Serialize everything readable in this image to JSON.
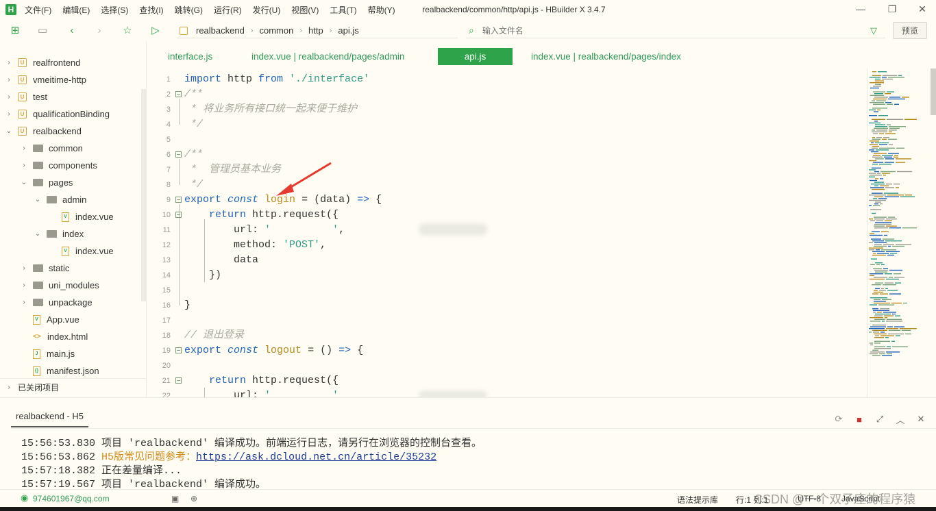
{
  "app": {
    "window_title": "realbackend/common/http/api.js - HBuilder X 3.4.7",
    "logo_letter": "H",
    "menu": [
      "文件(F)",
      "编辑(E)",
      "选择(S)",
      "查找(I)",
      "跳转(G)",
      "运行(R)",
      "发行(U)",
      "视图(V)",
      "工具(T)",
      "帮助(Y)"
    ]
  },
  "toolbar": {
    "breadcrumb": [
      "realbackend",
      "common",
      "http",
      "api.js"
    ],
    "file_search_placeholder": "输入文件名",
    "preview_label": "预览"
  },
  "sidebar": {
    "items": [
      {
        "label": "realfrontend",
        "type": "project",
        "arrow": "›"
      },
      {
        "label": "vmeitime-http",
        "type": "project",
        "arrow": "›"
      },
      {
        "label": "test",
        "type": "project",
        "arrow": "›"
      },
      {
        "label": "qualificationBinding",
        "type": "project",
        "arrow": "›"
      },
      {
        "label": "realbackend",
        "type": "project",
        "arrow": "⌄"
      },
      {
        "label": "common",
        "type": "folder",
        "arrow": "›"
      },
      {
        "label": "components",
        "type": "folder",
        "arrow": "›"
      },
      {
        "label": "pages",
        "type": "folder",
        "arrow": "⌄"
      },
      {
        "label": "admin",
        "type": "folder",
        "arrow": "⌄"
      },
      {
        "label": "index.vue",
        "type": "vue",
        "arrow": ""
      },
      {
        "label": "index",
        "type": "folder",
        "arrow": "⌄"
      },
      {
        "label": "index.vue",
        "type": "vue",
        "arrow": ""
      },
      {
        "label": "static",
        "type": "folder",
        "arrow": "›"
      },
      {
        "label": "uni_modules",
        "type": "folder",
        "arrow": "›"
      },
      {
        "label": "unpackage",
        "type": "folder",
        "arrow": "›"
      },
      {
        "label": "App.vue",
        "type": "vue",
        "arrow": ""
      },
      {
        "label": "index.html",
        "type": "html",
        "arrow": ""
      },
      {
        "label": "main.js",
        "type": "js",
        "arrow": ""
      },
      {
        "label": "manifest.json",
        "type": "json",
        "arrow": ""
      }
    ],
    "closed_projects_label": "已关闭项目"
  },
  "tabs": [
    {
      "label": "interface.js",
      "active": false
    },
    {
      "label": "index.vue | realbackend/pages/admin",
      "active": false
    },
    {
      "label": "api.js",
      "active": true
    },
    {
      "label": "index.vue | realbackend/pages/index",
      "active": false
    }
  ],
  "code": {
    "line_numbers": [
      "1",
      "2",
      "3",
      "4",
      "5",
      "6",
      "7",
      "8",
      "9",
      "10",
      "11",
      "12",
      "13",
      "14",
      "15",
      "16",
      "17",
      "18",
      "19",
      "20",
      "21",
      "22"
    ],
    "l1": {
      "kw": "import",
      "mid": " http ",
      "kw2": "from",
      "str": " './interface'"
    },
    "l2": "/**",
    "l3": " * 将业务所有接口统一起来便于维护",
    "l4": " */",
    "l6": "/**",
    "l7": " *  管理员基本业务",
    "l8": " */",
    "l9": {
      "kw": "export",
      "sp": " ",
      "kw2": "const",
      "fn": " login",
      "rest": " = (data) ",
      "arrow": "=>",
      "end": " {"
    },
    "l10": {
      "kw": "    return",
      "rest": " http.request({"
    },
    "l11": {
      "key": "        url: ",
      "str": "'          '",
      "end": ","
    },
    "l12": {
      "key": "        method: ",
      "str": "'POST'",
      "end": ","
    },
    "l13": "        data",
    "l14": "    })",
    "l16": "}",
    "l18": "// 退出登录",
    "l19": {
      "kw": "export",
      "sp": " ",
      "kw2": "const",
      "fn": " logout",
      "rest": " = () ",
      "arrow": "=>",
      "end": " {"
    },
    "l21": {
      "kw": "    return",
      "rest": " http.request({"
    },
    "l22": {
      "key": "        url: ",
      "str": "'          '"
    }
  },
  "console": {
    "tab_label": "realbackend - H5",
    "logs": [
      {
        "time": "15:56:53.830",
        "text": " 项目 'realbackend' 编译成功。前端运行日志，请另行在浏览器的控制台查看。"
      },
      {
        "time": "15:56:53.862",
        "warn": " H5版常见问题参考：",
        "link": "https://ask.dcloud.net.cn/article/35232"
      },
      {
        "time": "15:57:18.382",
        "text": " 正在差量编译..."
      },
      {
        "time": "15:57:19.567",
        "text": " 项目 'realbackend' 编译成功。"
      }
    ]
  },
  "status": {
    "user": "974601967@qq.com",
    "syntax_hint": "语法提示库",
    "position": "行:1 列:1",
    "encoding": "UTF-8",
    "language": "JavaScript",
    "watermark": "CSDN @一个双子座的程序猿"
  },
  "colors": {
    "accent": "#2fa34a",
    "background": "#fffdf3",
    "keyword": "#1f60b8",
    "string": "#2f9a86",
    "comment": "#a9aa9e",
    "function": "#b98a1e"
  }
}
